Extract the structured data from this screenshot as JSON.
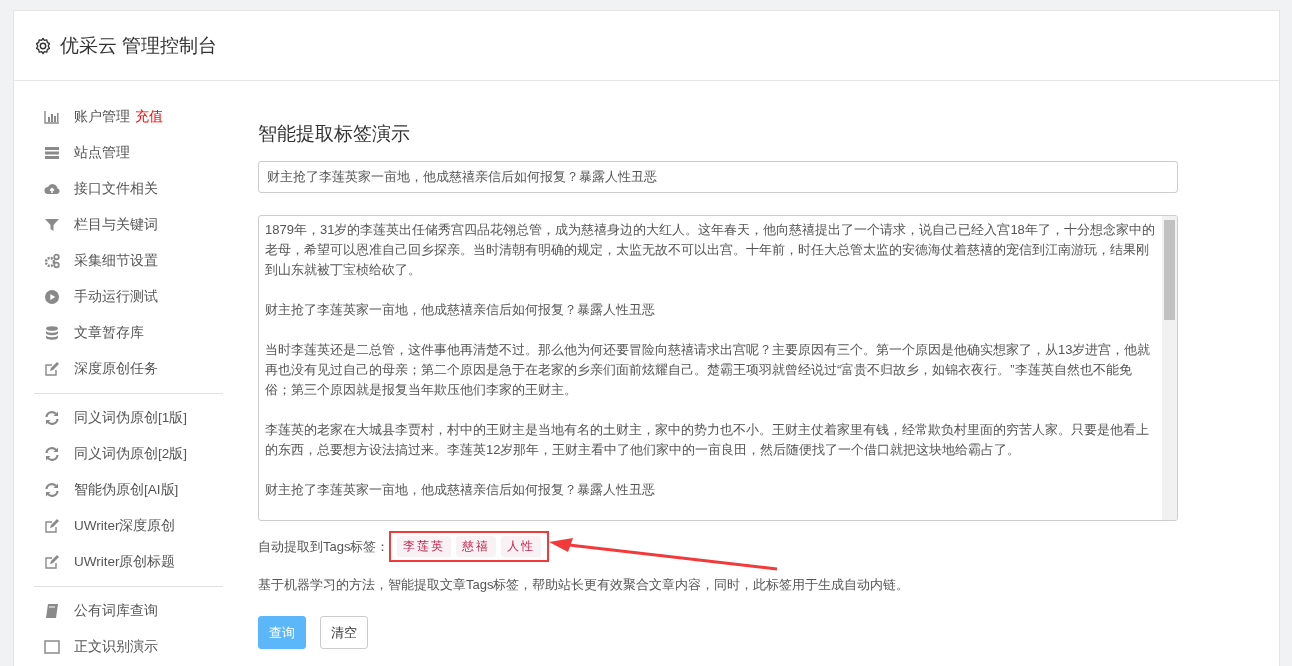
{
  "header": {
    "title": "优采云 管理控制台"
  },
  "sidebar": {
    "groups": [
      [
        {
          "label": "账户管理",
          "badge": "充值"
        },
        {
          "label": "站点管理"
        },
        {
          "label": "接口文件相关"
        },
        {
          "label": "栏目与关键词"
        },
        {
          "label": "采集细节设置"
        },
        {
          "label": "手动运行测试"
        },
        {
          "label": "文章暂存库"
        },
        {
          "label": "深度原创任务"
        }
      ],
      [
        {
          "label": "同义词伪原创[1版]"
        },
        {
          "label": "同义词伪原创[2版]"
        },
        {
          "label": "智能伪原创[AI版]"
        },
        {
          "label": "UWriter深度原创"
        },
        {
          "label": "UWriter原创标题"
        }
      ],
      [
        {
          "label": "公有词库查询"
        },
        {
          "label": "正文识别演示"
        }
      ]
    ]
  },
  "main": {
    "heading": "智能提取标签演示",
    "title_field": {
      "value": "财主抢了李莲英家一亩地，他成慈禧亲信后如何报复？暴露人性丑恶"
    },
    "body_field": {
      "paragraphs": [
        "1879年，31岁的李莲英出任储秀宫四品花翎总管，成为慈禧身边的大红人。这年春天，他向慈禧提出了一个请求，说自己已经入宫18年了，十分想念家中的老母，希望可以恩准自己回乡探亲。当时清朝有明确的规定，太监无故不可以出宫。十年前，时任大总管太监的安德海仗着慈禧的宠信到江南游玩，结果刚到山东就被丁宝桢给砍了。",
        "财主抢了李莲英家一亩地，他成慈禧亲信后如何报复？暴露人性丑恶",
        "当时李莲英还是二总管，这件事他再清楚不过。那么他为何还要冒险向慈禧请求出宫呢？主要原因有三个。第一个原因是他确实想家了，从13岁进宫，他就再也没有见过自己的母亲；第二个原因是急于在老家的乡亲们面前炫耀自己。楚霸王项羽就曾经说过“富贵不归故乡，如锦衣夜行。”李莲英自然也不能免俗；第三个原因就是报复当年欺压他们李家的王财主。",
        "李莲英的老家在大城县李贾村，村中的王财主是当地有名的土财主，家中的势力也不小。王财主仗着家里有钱，经常欺负村里面的穷苦人家。只要是他看上的东西，总要想方设法搞过来。李莲英12岁那年，王财主看中了他们家中的一亩良田，然后随便找了一个借口就把这块地给霸占了。",
        "财主抢了李莲英家一亩地，他成慈禧亲信后如何报复？暴露人性丑恶"
      ]
    },
    "tags_label": "自动提取到Tags标签：",
    "tags": [
      "李莲英",
      "慈禧",
      "人性"
    ],
    "note": "基于机器学习的方法，智能提取文章Tags标签，帮助站长更有效聚合文章内容，同时，此标签用于生成自动内链。",
    "buttons": [
      {
        "label": "查询",
        "kind": "primary"
      },
      {
        "label": "清空",
        "kind": "default"
      }
    ]
  }
}
